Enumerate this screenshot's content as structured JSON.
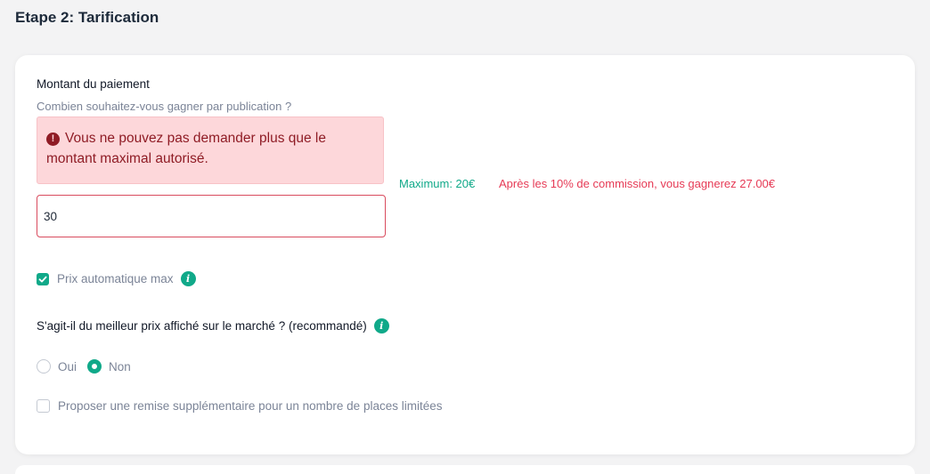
{
  "page": {
    "title": "Etape 2: Tarification"
  },
  "payment": {
    "label": "Montant du paiement",
    "help": "Combien souhaitez-vous gagner par publication ?",
    "error_message": "Vous ne pouvez pas demander plus que le montant maximal autorisé.",
    "amount_value": "30",
    "maximum_text": "Maximum: 20€",
    "commission_text": "Après les 10% de commission, vous gagnerez 27.00€"
  },
  "auto_price": {
    "label": "Prix automatique max",
    "checked": true
  },
  "best_price": {
    "question": "S'agit-il du meilleur prix affiché sur le marché ? (recommandé)",
    "options": [
      {
        "label": "Oui",
        "selected": false
      },
      {
        "label": "Non",
        "selected": true
      }
    ]
  },
  "discount": {
    "label": "Proposer une remise supplémentaire pour un nombre de places limitées",
    "checked": false
  },
  "icons": {
    "error": "exclamation-circle-icon",
    "info": "info-circle-icon",
    "check": "checkmark-icon"
  },
  "colors": {
    "accent": "#10a989",
    "error_text": "#8f1c25",
    "error_bg": "#fdd7da",
    "commission": "#e63a55"
  }
}
